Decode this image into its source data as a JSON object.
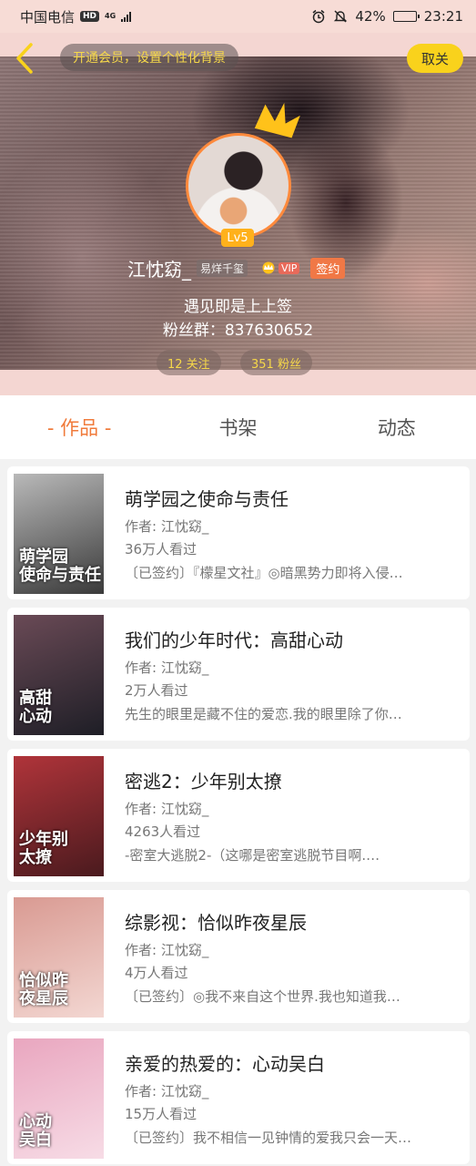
{
  "status_bar": {
    "carrier": "中国电信",
    "hd": "HD",
    "network": "4G",
    "battery": "42%",
    "battery_level": 0.42,
    "time": "23:21"
  },
  "header": {
    "vip_prompt": "开通会员，设置个性化背景",
    "cancel_label": "取关",
    "level": "Lv5",
    "name": "江忱窈_",
    "nickname_tag": "易烊千玺",
    "vip_label": "VIP",
    "sign_label": "签约",
    "bio_line1": "遇见即是上上签",
    "bio_line2": "粉丝群：837630652",
    "follow_count": "12 关注",
    "fans_count": "351 粉丝"
  },
  "tabs": [
    {
      "label": "- 作品 -",
      "active": true
    },
    {
      "label": "书架",
      "active": false
    },
    {
      "label": "动态",
      "active": false
    }
  ],
  "works": [
    {
      "title": "萌学园之使命与责任",
      "author": "作者: 江忱窈_",
      "views": "36万人看过",
      "desc": "〔已签约〕『檬星文社』◎暗黑势力即将入侵…",
      "cover_text": "萌学园\n使命与责任",
      "cover_colors": [
        "#3a3a3a",
        "#b9b9b9"
      ]
    },
    {
      "title": "我们的少年时代：高甜心动",
      "author": "作者: 江忱窈_",
      "views": "2万人看过",
      "desc": "先生的眼里是藏不住的爱恋.我的眼里除了你…",
      "cover_text": "高甜\n心动",
      "cover_colors": [
        "#1e1e26",
        "#6a4a56"
      ]
    },
    {
      "title": "密逃2：少年别太撩",
      "author": "作者: 江忱窈_",
      "views": "4263人看过",
      "desc": "-密室大逃脱2-（这哪是密室逃脱节目啊.…",
      "cover_text": "少年别\n太撩",
      "cover_colors": [
        "#4a1a1e",
        "#b0343a"
      ]
    },
    {
      "title": "综影视：恰似昨夜星辰",
      "author": "作者: 江忱窈_",
      "views": "4万人看过",
      "desc": "〔已签约〕◎我不来自这个世界.我也知道我…",
      "cover_text": "恰似昨\n夜星辰",
      "cover_colors": [
        "#f3d7d2",
        "#d99a92"
      ]
    },
    {
      "title": "亲爱的热爱的：心动吴白",
      "author": "作者: 江忱窈_",
      "views": "15万人看过",
      "desc": "〔已签约〕我不相信一见钟情的爱我只会一天…",
      "cover_text": "心动\n吴白",
      "cover_colors": [
        "#f7dce6",
        "#e9a6bf"
      ]
    }
  ]
}
